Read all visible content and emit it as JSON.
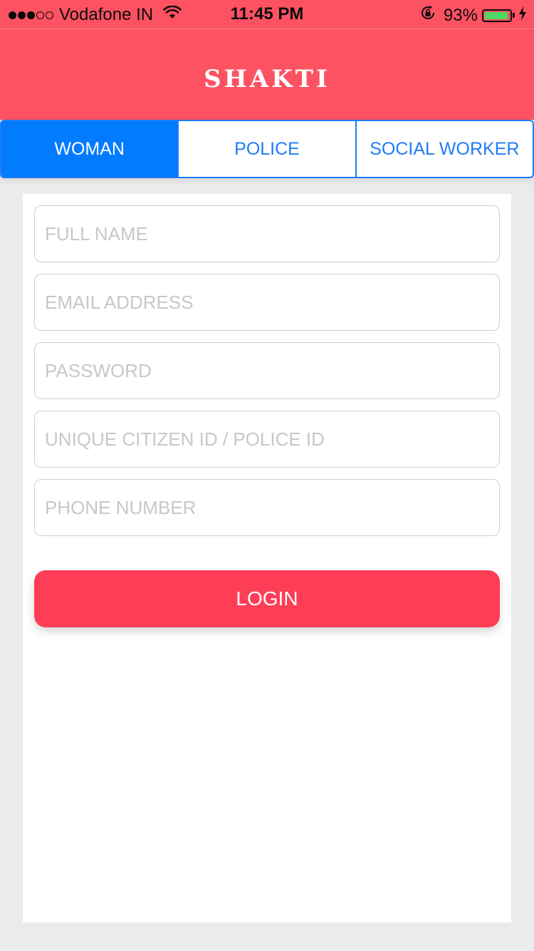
{
  "status_bar": {
    "carrier": "Vodafone IN",
    "time": "11:45 PM",
    "battery_percent": "93%",
    "battery_level": 0.93,
    "signal_bars_filled": 3,
    "signal_bars_total": 5,
    "icons": [
      "signal-icon",
      "wifi-icon",
      "orientation-lock-icon",
      "battery-icon",
      "charging-bolt-icon"
    ]
  },
  "header": {
    "title": "SHAKTI"
  },
  "segments": {
    "items": [
      {
        "label": "WOMAN",
        "selected": true
      },
      {
        "label": "POLICE",
        "selected": false
      },
      {
        "label": "SOCIAL WORKER",
        "selected": false
      }
    ]
  },
  "form": {
    "full_name": {
      "placeholder": "FULL NAME",
      "value": ""
    },
    "email": {
      "placeholder": "EMAIL ADDRESS",
      "value": ""
    },
    "password": {
      "placeholder": "PASSWORD",
      "value": ""
    },
    "citizen_id": {
      "placeholder": "UNIQUE CITIZEN ID / POLICE ID",
      "value": ""
    },
    "phone": {
      "placeholder": "PHONE NUMBER",
      "value": ""
    },
    "login_label": "LOGIN"
  },
  "colors": {
    "header_bg": "#fd5262",
    "segment_active": "#027bff",
    "segment_accent": "#1f7cf6",
    "login_bg": "#fe3e57",
    "page_bg": "#ebebeb"
  }
}
